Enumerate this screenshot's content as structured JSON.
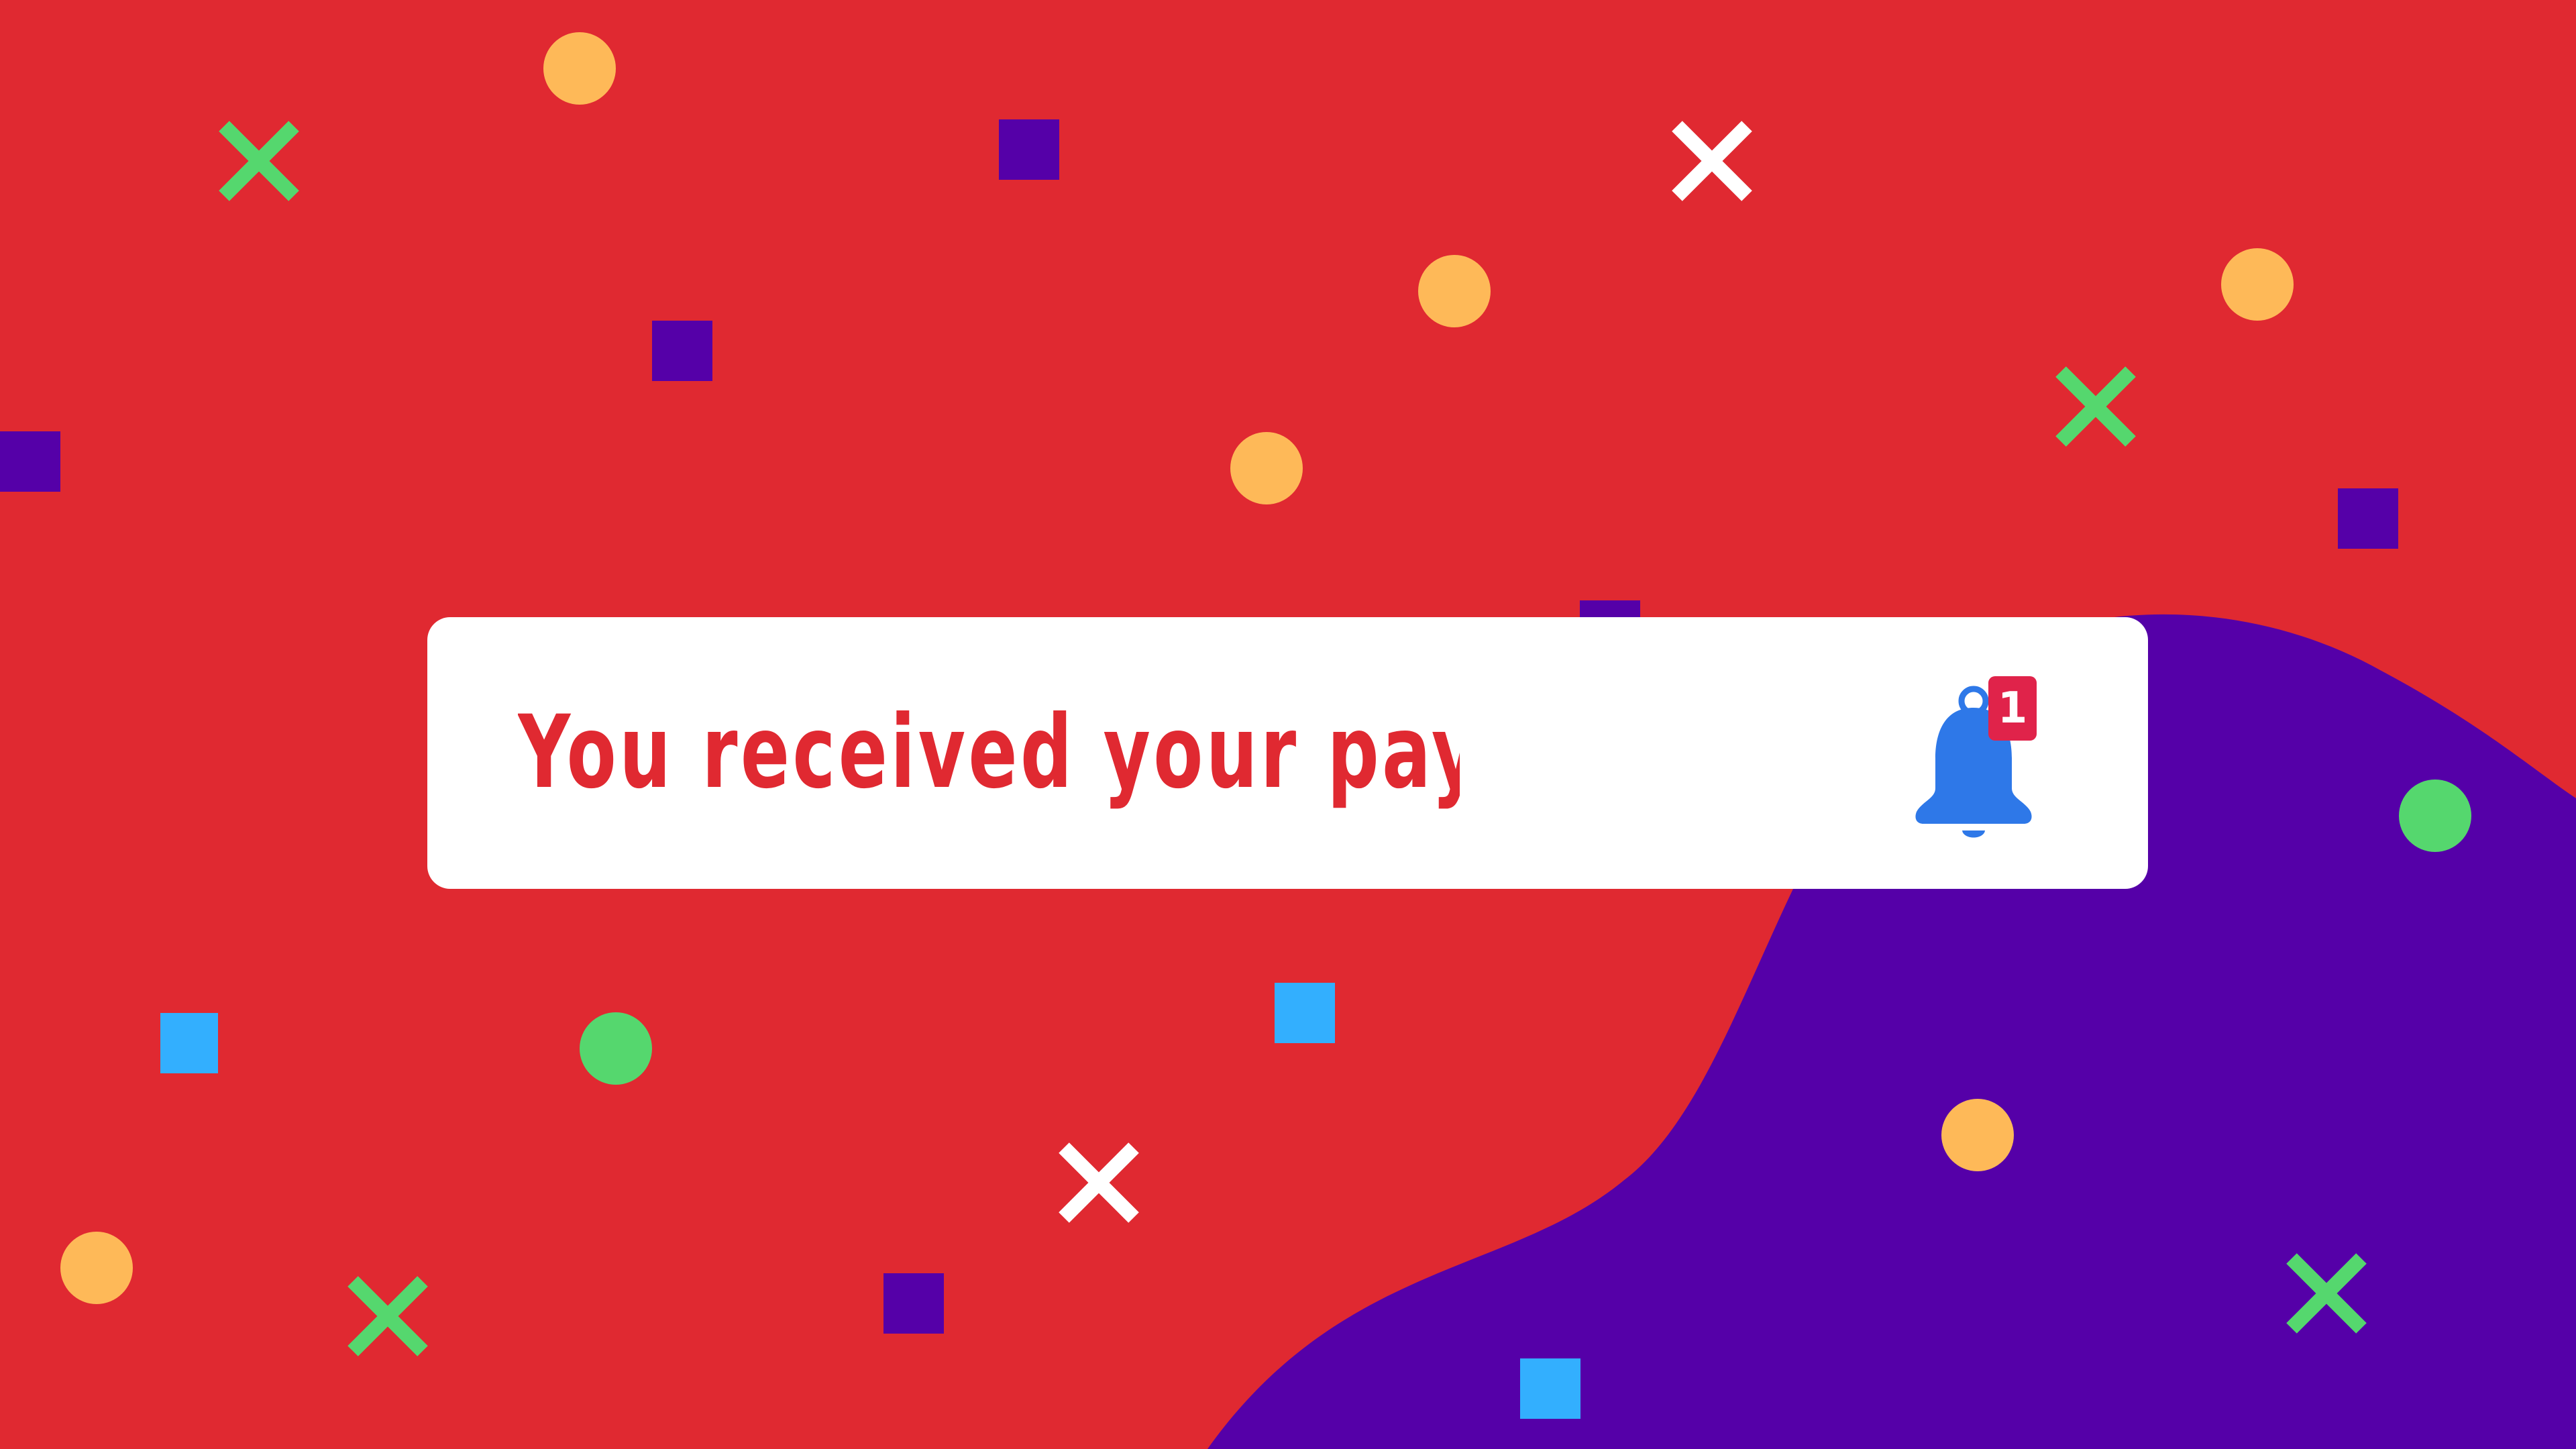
{
  "notification": {
    "message": "You received your payout!",
    "badge_count": "1",
    "icon": "bell-icon"
  },
  "colors": {
    "background": "#E02931",
    "blob": "#5500A8",
    "card": "#FFFFFF",
    "text": "#E02931",
    "bell": "#2E78E8",
    "badge": "#E0234A",
    "confetti_circle_yellow": "#FEB958",
    "confetti_circle_green": "#55D76E",
    "confetti_x_green": "#55D76E",
    "confetti_x_white": "#FFFFFF",
    "confetti_square_purple": "#5500A8",
    "confetti_square_blue": "#33AFFE"
  }
}
